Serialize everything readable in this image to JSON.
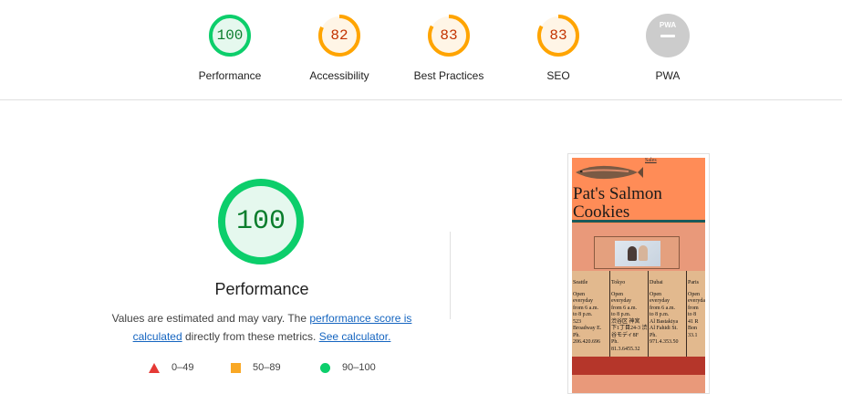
{
  "categories": [
    {
      "label": "Performance",
      "score": "100",
      "status": "pass",
      "color": "#0cce6b",
      "text_color": "#0a7d2c",
      "fill": "#e5f8ee",
      "fraction": 1.0
    },
    {
      "label": "Accessibility",
      "score": "82",
      "status": "average",
      "color": "#ffa400",
      "text_color": "#c33300",
      "fill": "#fff5e6",
      "fraction": 0.82
    },
    {
      "label": "Best Practices",
      "score": "83",
      "status": "average",
      "color": "#ffa400",
      "text_color": "#c33300",
      "fill": "#fff5e6",
      "fraction": 0.83
    },
    {
      "label": "SEO",
      "score": "83",
      "status": "average",
      "color": "#ffa400",
      "text_color": "#c33300",
      "fill": "#fff5e6",
      "fraction": 0.83
    },
    {
      "label": "PWA",
      "score": "",
      "status": "na",
      "color": "#cccccc",
      "badge_text": "PWA"
    }
  ],
  "main": {
    "score": "100",
    "title": "Performance",
    "desc_prefix": "Values are estimated and may vary. The ",
    "desc_link1": "performance score is calculated",
    "desc_middle": " directly from these metrics. ",
    "desc_link2": "See calculator."
  },
  "legend": [
    {
      "range": "0–49",
      "shape": "triangle",
      "color": "#e53935"
    },
    {
      "range": "50–89",
      "shape": "square",
      "color": "#f9a825"
    },
    {
      "range": "90–100",
      "shape": "circle",
      "color": "#0cce6b"
    }
  ],
  "screenshot": {
    "nav_link": "Sales",
    "heading_line1": "Pat's Salmon",
    "heading_line2": "Cookies",
    "stores": [
      {
        "city": "Seattle",
        "hours": [
          "Open",
          "everyday",
          "from 6 a.m.",
          "to 8 p.m."
        ],
        "address": [
          "523",
          "Broadway E.",
          "Ph.",
          "206.420.696"
        ]
      },
      {
        "city": "Tokyo",
        "hours": [
          "Open",
          "everyday",
          "from 6 a.m.",
          "to 8 p.m."
        ],
        "address": [
          "渋谷区 神宮",
          "下1丁目24-3 渋",
          "谷モディ8F",
          "Ph. 81.3.6455.32"
        ]
      },
      {
        "city": "Dubai",
        "hours": [
          "Open",
          "everyday",
          "from 6 a.m.",
          "to 8 p.m."
        ],
        "address": [
          "Al Bastakiya",
          "Al Fahidi St.",
          "Ph. 971.4.353.50"
        ]
      },
      {
        "city": "Paris",
        "hours": [
          "Open",
          "everyday",
          "from",
          "to 8"
        ],
        "address": [
          "41 R",
          "Bon",
          "33.1"
        ]
      }
    ]
  }
}
